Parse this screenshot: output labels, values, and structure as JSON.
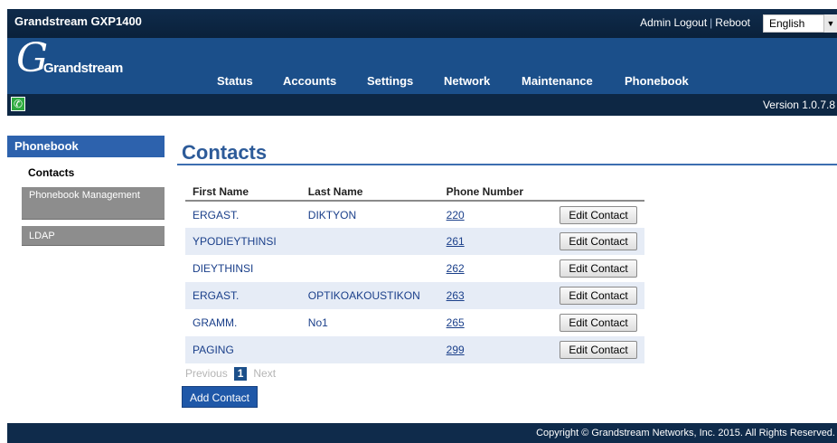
{
  "header": {
    "device_title": "Grandstream GXP1400",
    "admin_logout": "Admin Logout",
    "separator": "|",
    "reboot": "Reboot",
    "language": "English",
    "logo_text": "Grandstream",
    "version": "Version 1.0.7.8"
  },
  "nav": {
    "items": [
      "Status",
      "Accounts",
      "Settings",
      "Network",
      "Maintenance",
      "Phonebook"
    ]
  },
  "sidebar": {
    "section": "Phonebook",
    "active": "Contacts",
    "items": [
      "Phonebook Management",
      "LDAP"
    ]
  },
  "main": {
    "title": "Contacts",
    "columns": [
      "First Name",
      "Last Name",
      "Phone Number"
    ],
    "edit_label": "Edit Contact",
    "rows": [
      {
        "first": "ERGAST.",
        "last": "DIKTYON",
        "phone": "220"
      },
      {
        "first": "YPODIEYTHINSI",
        "last": "",
        "phone": "261"
      },
      {
        "first": "DIEYTHINSI",
        "last": "",
        "phone": "262"
      },
      {
        "first": "ERGAST.",
        "last": "OPTIKOAKOUSTIKON",
        "phone": "263"
      },
      {
        "first": "GRAMM.",
        "last": "No1",
        "phone": "265"
      },
      {
        "first": "PAGING",
        "last": "",
        "phone": "299"
      }
    ],
    "pager": {
      "previous": "Previous",
      "current": "1",
      "next": "Next"
    },
    "add_label": "Add Contact"
  },
  "footer": {
    "copyright": "Copyright © Grandstream Networks, Inc. 2015. All Rights Reserved."
  }
}
